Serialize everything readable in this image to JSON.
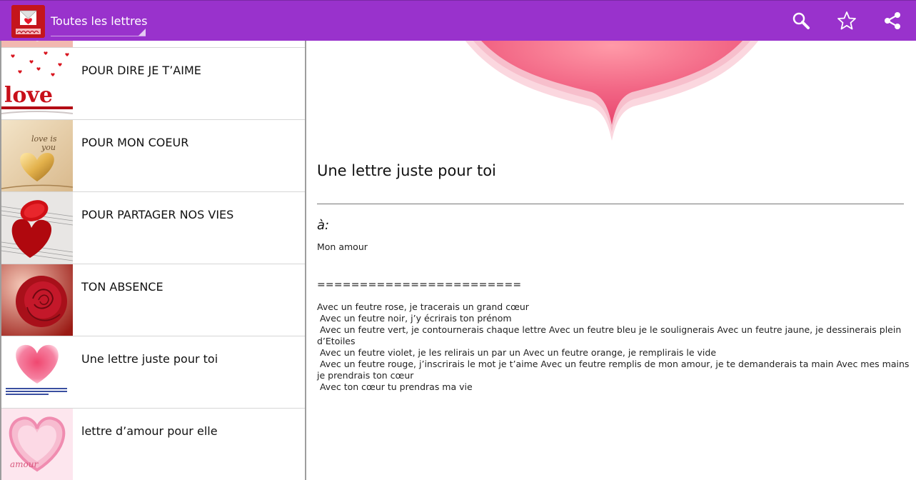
{
  "appbar": {
    "title": "Toutes les lettres",
    "app_icon_text": "Lettres d'amour",
    "actions": [
      {
        "name": "search",
        "icon": "search-icon"
      },
      {
        "name": "favorite",
        "icon": "star-icon"
      },
      {
        "name": "share",
        "icon": "share-icon"
      }
    ]
  },
  "list": {
    "items": [
      {
        "title": "POUR DIRE JE T’AIME",
        "thumb": "love-icon"
      },
      {
        "title": "POUR MON COEUR",
        "thumb": "gold-heart-icon",
        "thumb_text": "love is you"
      },
      {
        "title": "POUR PARTAGER NOS VIES",
        "thumb": "red-heart-box-icon"
      },
      {
        "title": "TON ABSENCE",
        "thumb": "rose-icon"
      },
      {
        "title": "Une lettre juste pour toi",
        "thumb": "pink-heart-icon"
      },
      {
        "title": "lettre d’amour pour elle",
        "thumb": "pink-heart-outline-icon",
        "thumb_text": "amour"
      }
    ]
  },
  "detail": {
    "title": "Une lettre juste pour toi",
    "to_label": "à:",
    "recipient": "Mon amour",
    "separator": "========================",
    "lines": [
      "Avec un feutre rose, je tracerais un grand cœur",
      " Avec un feutre noir, j’y écrirais ton prénom",
      " Avec un feutre vert, je contournerais chaque lettre Avec un feutre bleu je le soulignerais Avec un feutre jaune, je dessinerais plein d’Etoiles",
      " Avec un feutre violet, je les relirais un par un Avec un feutre orange, je remplirais le vide",
      " Avec un feutre rouge, j’inscrirais le mot je t’aime Avec un feutre remplis de mon amour, je te demanderais ta main Avec mes mains je prendrais ton cœur",
      " Avec ton cœur tu prendras ma vie"
    ]
  },
  "colors": {
    "appbar": "#9932cc",
    "heart_pink": "#f0607f",
    "rose_red": "#b0101a"
  }
}
